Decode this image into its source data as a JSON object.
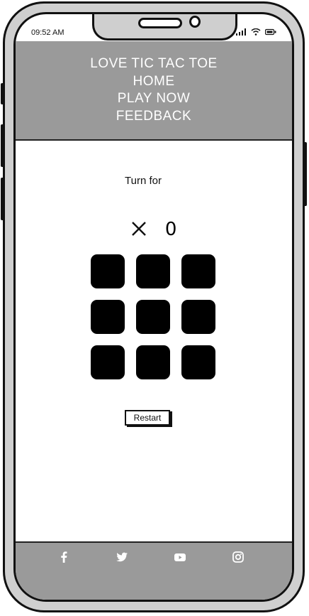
{
  "status_bar": {
    "time": "09:52 AM",
    "signal_icon": "signal-bars-icon",
    "wifi_icon": "wifi-icon",
    "battery_icon": "battery-icon"
  },
  "nav": {
    "title": "LOVE TIC TAC TOE",
    "items": [
      "HOME",
      "PLAY NOW",
      "FEEDBACK"
    ]
  },
  "game": {
    "turn_label": "Turn for",
    "players": [
      "X",
      "0"
    ],
    "cells": [
      "",
      "",
      "",
      "",
      "",
      "",
      "",
      "",
      ""
    ],
    "restart_label": "Restart"
  },
  "footer": {
    "icons": [
      "facebook-icon",
      "twitter-icon",
      "youtube-icon",
      "instagram-icon"
    ]
  },
  "colors": {
    "header_bg": "#9a9a9a",
    "cell_color": "#000000",
    "phone_frame": "#cfcfcf"
  }
}
